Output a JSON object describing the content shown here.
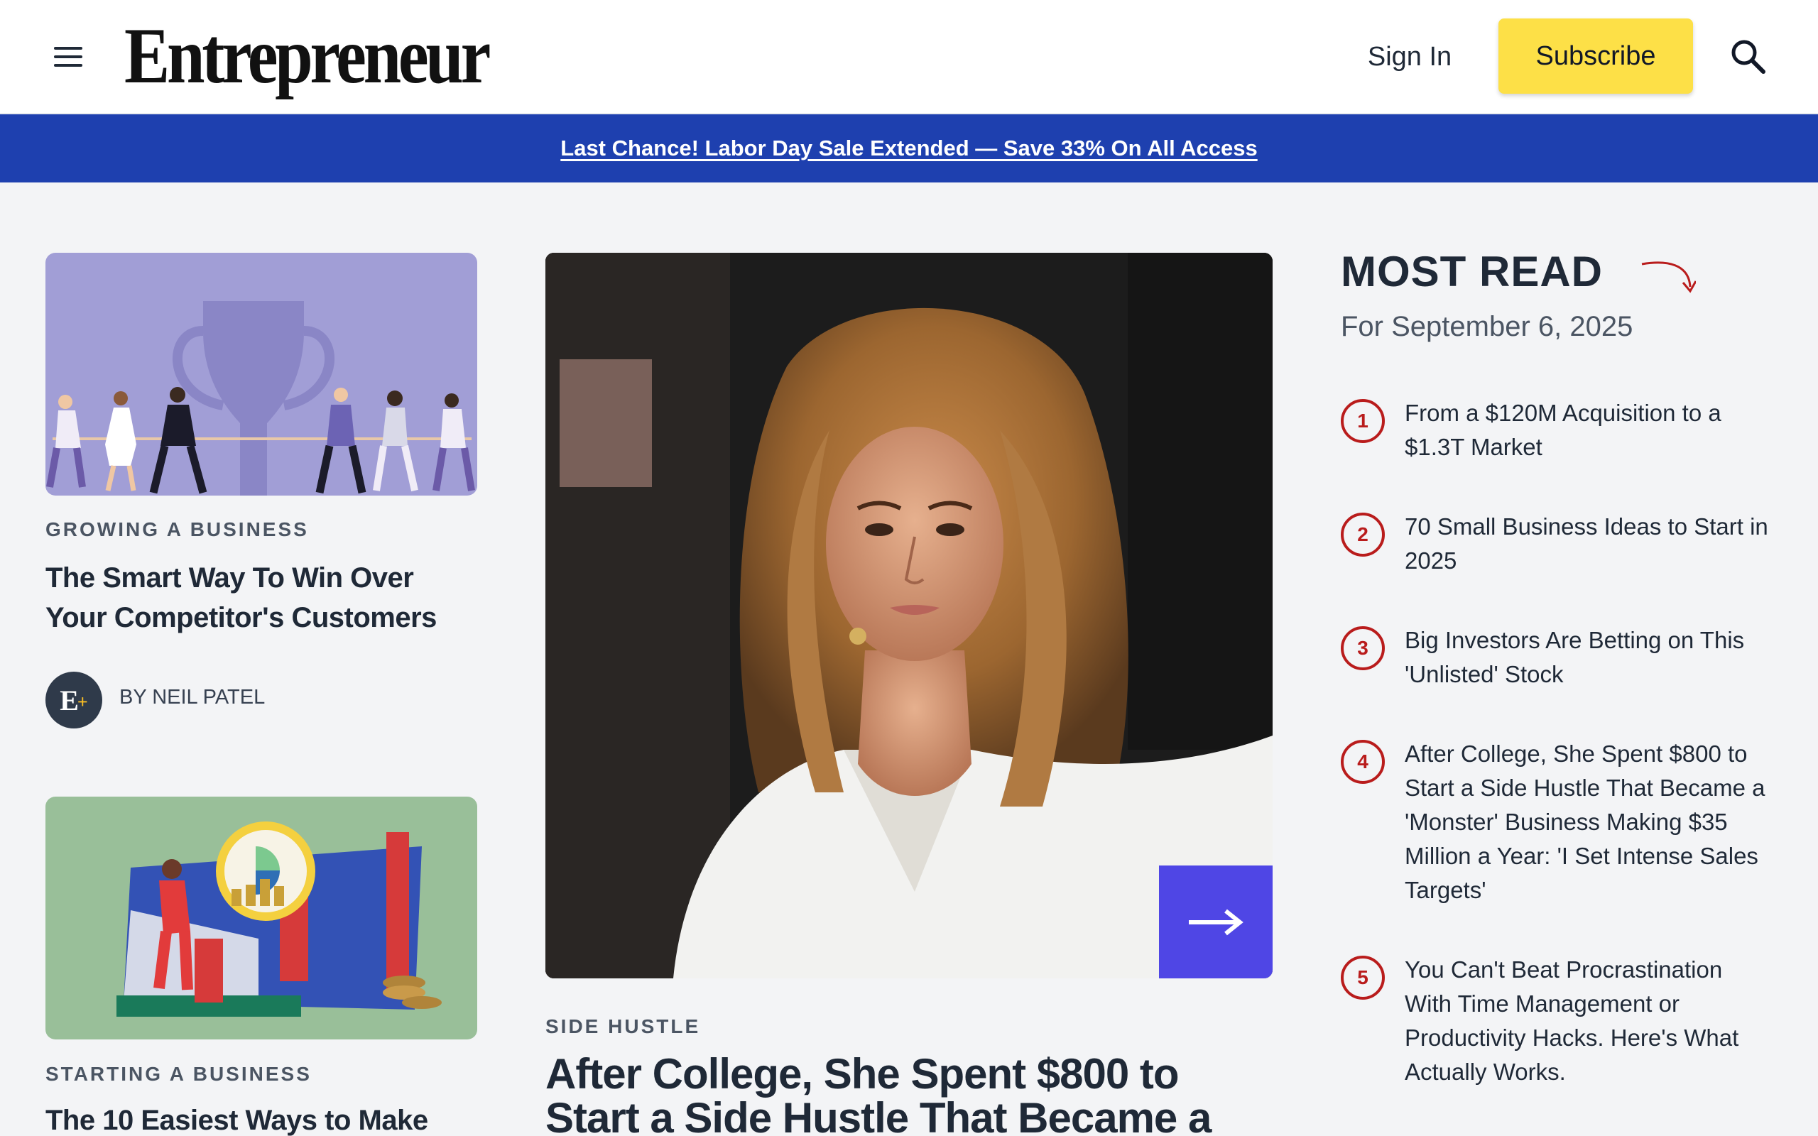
{
  "header": {
    "logo": "Entrepreneur",
    "sign_in": "Sign In",
    "subscribe": "Subscribe"
  },
  "promo": {
    "text": "Last Chance! Labor Day Sale Extended — Save 33% On All Access"
  },
  "cards": [
    {
      "category": "GROWING A BUSINESS",
      "title": "The Smart Way To Win Over Your Competitor's Customers",
      "author": "BY NEIL PATEL"
    },
    {
      "category": "STARTING A BUSINESS",
      "title": "The 10 Easiest Ways to Make"
    }
  ],
  "feature": {
    "category": "SIDE HUSTLE",
    "title": "After College, She Spent $800 to Start a Side Hustle That Became a"
  },
  "most_read": {
    "heading": "MOST READ",
    "date": "For September 6, 2025",
    "items": [
      {
        "num": "1",
        "text": "From a $120M Acquisition to a $1.3T Market"
      },
      {
        "num": "2",
        "text": "70 Small Business Ideas to Start in 2025"
      },
      {
        "num": "3",
        "text": "Big Investors Are Betting on This 'Unlisted' Stock"
      },
      {
        "num": "4",
        "text": "After College, She Spent $800 to Start a Side Hustle That Became a 'Monster' Business Making $35 Million a Year: 'I Set Intense Sales Targets'"
      },
      {
        "num": "5",
        "text": "You Can't Beat Procrastination With Time Management or Productivity Hacks. Here's What Actually Works."
      }
    ]
  },
  "colors": {
    "promo_bg": "#1e40af",
    "subscribe_bg": "#fde047",
    "accent_red": "#b91c1c",
    "arrow_button": "#4f46e5",
    "page_bg": "#f3f4f6"
  },
  "icons": [
    "hamburger-menu-icon",
    "search-icon",
    "arrow-right-icon",
    "curved-arrow-icon"
  ]
}
